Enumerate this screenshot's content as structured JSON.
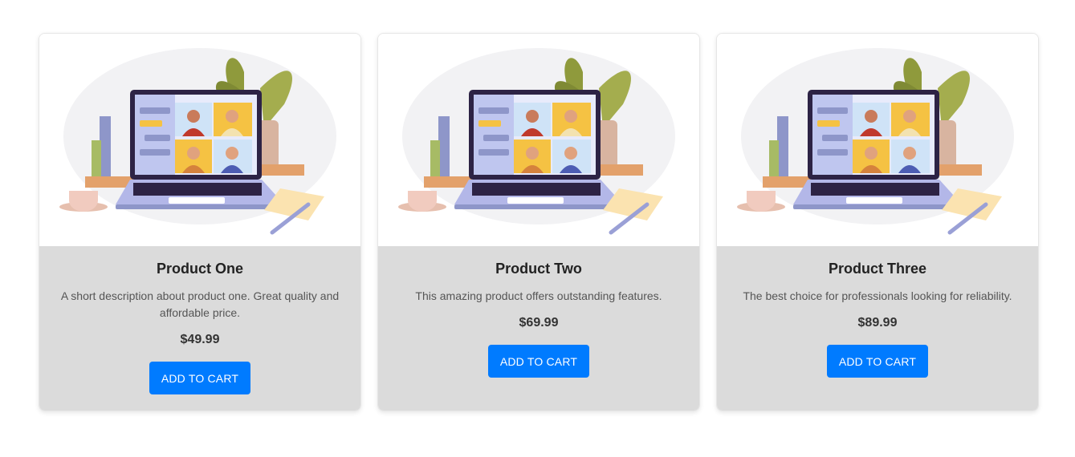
{
  "products": [
    {
      "title": "Product One",
      "description": "A short description about product one. Great quality and affordable price.",
      "price": "$49.99",
      "button_label": "ADD TO CART"
    },
    {
      "title": "Product Two",
      "description": "This amazing product offers outstanding features.",
      "price": "$69.99",
      "button_label": "ADD TO CART"
    },
    {
      "title": "Product Three",
      "description": "The best choice for professionals looking for reliability.",
      "price": "$89.99",
      "button_label": "ADD TO CART"
    }
  ],
  "colors": {
    "button": "#007bff",
    "card_body": "#dbdbdb",
    "laptop": "#b3b7e8"
  },
  "illustration": "laptop-video-call-illustration"
}
